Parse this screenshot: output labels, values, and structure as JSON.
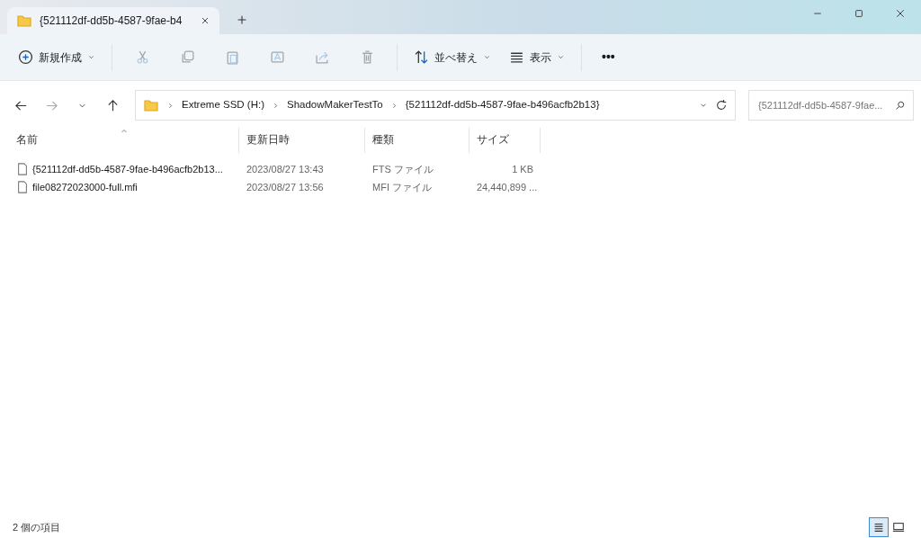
{
  "tab": {
    "title": "{521112df-dd5b-4587-9fae-b4",
    "selected": true
  },
  "toolbar": [
    {
      "kind": "new",
      "label": "新規作成",
      "disabled": false,
      "dropdown": true
    },
    {
      "kind": "sep"
    },
    {
      "kind": "cut",
      "disabled": true
    },
    {
      "kind": "copy",
      "disabled": true
    },
    {
      "kind": "paste",
      "disabled": true
    },
    {
      "kind": "rename",
      "disabled": true
    },
    {
      "kind": "share",
      "disabled": true
    },
    {
      "kind": "delete",
      "disabled": true
    },
    {
      "kind": "sep"
    },
    {
      "kind": "sort",
      "label": "並べ替え",
      "disabled": false,
      "dropdown": true
    },
    {
      "kind": "view",
      "label": "表示",
      "disabled": false,
      "dropdown": true
    },
    {
      "kind": "sep"
    },
    {
      "kind": "more",
      "label": "•••"
    }
  ],
  "nav": [
    {
      "kind": "back",
      "disabled": false
    },
    {
      "kind": "forward",
      "disabled": true
    },
    {
      "kind": "recent",
      "disabled": false
    },
    {
      "kind": "up",
      "disabled": false
    }
  ],
  "breadcrumb": [
    "Extreme SSD (H:)",
    "ShadowMakerTestTo",
    "{521112df-dd5b-4587-9fae-b496acfb2b13}"
  ],
  "search": {
    "placeholder": "{521112df-dd5b-4587-9fae..."
  },
  "columns": [
    {
      "label": "名前",
      "sorted": true
    },
    {
      "label": "更新日時",
      "sorted": false
    },
    {
      "label": "種類",
      "sorted": false
    },
    {
      "label": "サイズ",
      "sorted": false
    }
  ],
  "rows": [
    {
      "name": "{521112df-dd5b-4587-9fae-b496acfb2b13...",
      "modified": "2023/08/27 13:43",
      "type": "FTS ファイル",
      "size": "1 KB"
    },
    {
      "name": "file08272023000-full.mfi",
      "modified": "2023/08/27 13:56",
      "type": "MFI ファイル",
      "size": "24,440,899 ..."
    }
  ],
  "status_bar": {
    "text": "2 個の項目",
    "views": [
      {
        "kind": "details",
        "selected": true
      },
      {
        "kind": "tiles",
        "selected": false
      }
    ]
  }
}
